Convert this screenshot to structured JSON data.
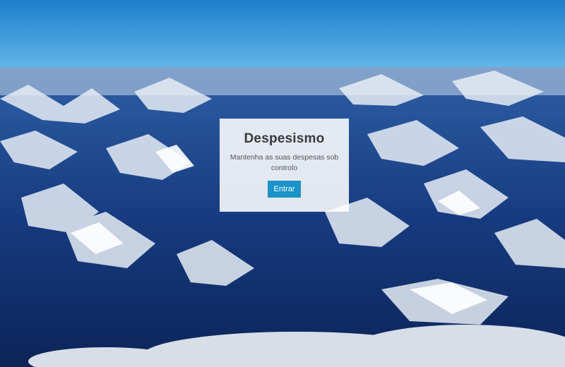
{
  "app": {
    "title": "Despesismo",
    "subtitle": "Mantenha as suas despesas sob controlo",
    "enter_label": "Entrar"
  },
  "colors": {
    "sky_top": "#1f86cf",
    "sky_bottom": "#5fb3e6",
    "mountain_dark": "#0e2a66",
    "snow": "#e8eef5",
    "button": "#1b93c9"
  },
  "icons": {
    "background": "snowy-mountains-aerial-image"
  }
}
